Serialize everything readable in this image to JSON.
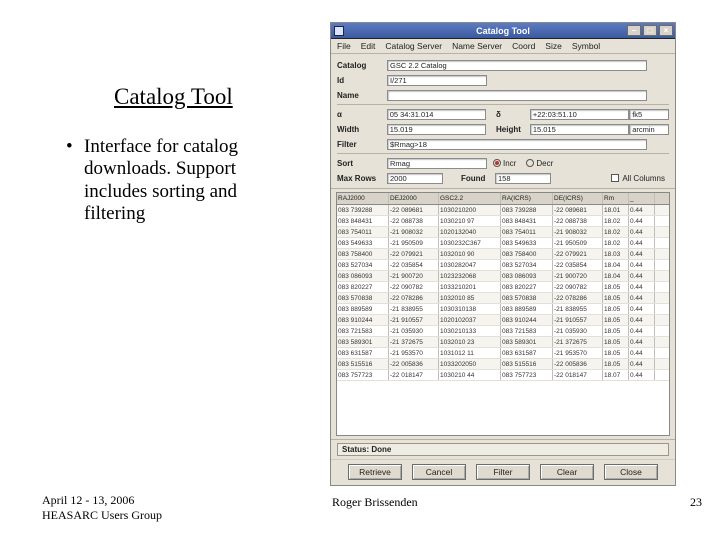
{
  "slide": {
    "title": "Catalog Tool",
    "bullet": "Interface for catalog downloads. Support includes sorting and filtering",
    "footer_left_line1": "April 12 - 13, 2006",
    "footer_left_line2": "HEASARC Users Group",
    "footer_center": "Roger Brissenden",
    "page_number": "23"
  },
  "window": {
    "title": "Catalog Tool",
    "buttons": {
      "min": "–",
      "max": "□",
      "close": "×"
    },
    "menus": [
      "File",
      "Edit",
      "Catalog Server",
      "Name Server",
      "Coord",
      "Size",
      "Symbol"
    ]
  },
  "form": {
    "catalog_label": "Catalog",
    "catalog_value": "GSC 2.2 Catalog",
    "id_label": "Id",
    "id_value": "I/271",
    "name_label": "Name",
    "name_value": "",
    "alpha_label": "α",
    "alpha_value": "05 34:31.014",
    "delta_label": "δ",
    "delta_value": "+22:03:51.10",
    "frame_value": "fk5",
    "width_label": "Width",
    "width_value": "15.019",
    "height_label": "Height",
    "height_value": "15.015",
    "unit_value": "arcmin",
    "filter_label": "Filter",
    "filter_value": "$Rmag>18",
    "sort_label": "Sort",
    "sort_value": "Rmag",
    "incr_label": "Incr",
    "decr_label": "Decr",
    "maxrows_label": "Max Rows",
    "maxrows_value": "2000",
    "found_label": "Found",
    "found_value": "158",
    "allcols_label": "All Columns"
  },
  "grid": {
    "headers": [
      "RAJ2000",
      "DEJ2000",
      "GSC2.2",
      "RA(ICRS)",
      "DE(ICRS)",
      "Rm",
      "_"
    ],
    "rows": [
      [
        "083 739288",
        "-22 089681",
        "1030210200",
        "083 739288",
        "-22 089681",
        "18.01",
        "0.44"
      ],
      [
        "083 848431",
        "-22 088738",
        "1030210  97",
        "083 848431",
        "-22 088738",
        "18.02",
        "0.44"
      ],
      [
        "083 754011",
        "-21 908032",
        "1020132040",
        "083 754011",
        "-21 908032",
        "18.02",
        "0.44"
      ],
      [
        "083 549633",
        "-21 950509",
        "1030232C367",
        "083 549633",
        "-21 950509",
        "18.02",
        "0.44"
      ],
      [
        "083 758400",
        "-22 079921",
        "1032010  90",
        "083 758400",
        "-22 079921",
        "18.03",
        "0.44"
      ],
      [
        "083 527034",
        "-22 035854",
        "1030282047",
        "083 527034",
        "-22 035854",
        "18.04",
        "0.44"
      ],
      [
        "083 086093",
        "-21 900720",
        "1023232068",
        "083 086093",
        "-21 900720",
        "18.04",
        "0.44"
      ],
      [
        "083 820227",
        "-22 090782",
        "1033210201",
        "083 820227",
        "-22 090782",
        "18.05",
        "0.44"
      ],
      [
        "083 570838",
        "-22 078286",
        "1032010  85",
        "083 570838",
        "-22 078286",
        "18.05",
        "0.44"
      ],
      [
        "083 889589",
        "-21 838955",
        "1030310138",
        "083 889589",
        "-21 838955",
        "18.05",
        "0.44"
      ],
      [
        "083 910244",
        "-21 910557",
        "1020102037",
        "083 910244",
        "-21 910557",
        "18.05",
        "0.44"
      ],
      [
        "083 721583",
        "-21 035930",
        "1030210133",
        "083 721583",
        "-21 035930",
        "18.05",
        "0.44"
      ],
      [
        "083 589301",
        "-21 372675",
        "1032010  23",
        "083 589301",
        "-21 372675",
        "18.05",
        "0.44"
      ],
      [
        "083 631587",
        "-21 953570",
        "1031012  11",
        "083 631587",
        "-21 953570",
        "18.05",
        "0.44"
      ],
      [
        "083 515516",
        "-22 005836",
        "1033202050",
        "083 515516",
        "-22 005836",
        "18.05",
        "0.44"
      ],
      [
        "083 757723",
        "-22 018147",
        "1030210  44",
        "083 757723",
        "-22 018147",
        "18.07",
        "0.44"
      ]
    ]
  },
  "status": {
    "label": "Status:",
    "value": "Done"
  },
  "bottom_buttons": [
    "Retrieve",
    "Cancel",
    "Filter",
    "Clear",
    "Close"
  ]
}
